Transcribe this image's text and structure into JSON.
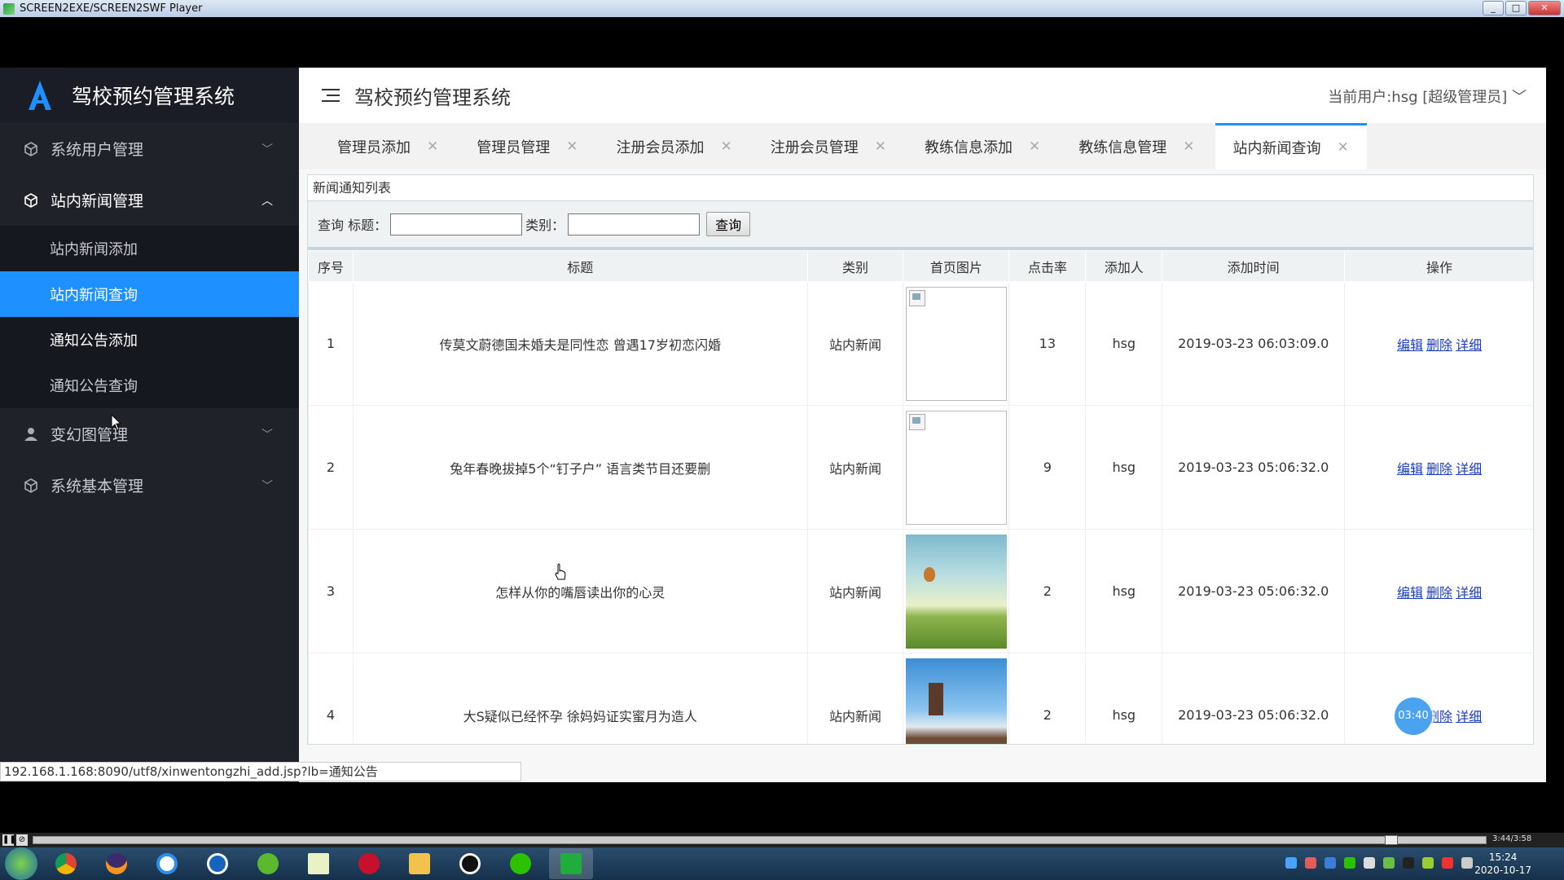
{
  "window": {
    "title": "SCREEN2EXE/SCREEN2SWF Player"
  },
  "sidebar": {
    "brand": "驾校预约管理系统",
    "menus": [
      {
        "label": "系统用户管理",
        "icon": "cube-icon",
        "expanded": false
      },
      {
        "label": "站内新闻管理",
        "icon": "cube-icon",
        "expanded": true,
        "children": [
          {
            "label": "站内新闻添加"
          },
          {
            "label": "站内新闻查询",
            "active": true
          },
          {
            "label": "通知公告添加"
          },
          {
            "label": "通知公告查询"
          }
        ]
      },
      {
        "label": "变幻图管理",
        "icon": "user-icon",
        "expanded": false
      },
      {
        "label": "系统基本管理",
        "icon": "cube-icon",
        "expanded": false
      }
    ]
  },
  "header": {
    "title": "驾校预约管理系统",
    "user": "当前用户:hsg [超级管理员]"
  },
  "tabs": [
    {
      "label": "管理员添加"
    },
    {
      "label": "管理员管理"
    },
    {
      "label": "注册会员添加"
    },
    {
      "label": "注册会员管理"
    },
    {
      "label": "教练信息添加"
    },
    {
      "label": "教练信息管理"
    },
    {
      "label": "站内新闻查询",
      "active": true
    }
  ],
  "panel": {
    "title": "新闻通知列表",
    "search": {
      "prefix": "查询",
      "title_label": "标题：",
      "title_value": "",
      "category_label": "类别：",
      "category_value": "",
      "button": "查询"
    },
    "columns": [
      "序号",
      "标题",
      "类别",
      "首页图片",
      "点击率",
      "添加人",
      "添加时间",
      "操作"
    ],
    "rows": [
      {
        "no": "1",
        "title": "传莫文蔚德国未婚夫是同性恋 曾遇17岁初恋闪婚",
        "category": "站内新闻",
        "image": "broken",
        "clicks": "13",
        "user": "hsg",
        "time": "2019-03-23 06:03:09.0"
      },
      {
        "no": "2",
        "title": "兔年春晚拔掉5个“钉子户” 语言类节目还要删",
        "category": "站内新闻",
        "image": "broken",
        "clicks": "9",
        "user": "hsg",
        "time": "2019-03-23 05:06:32.0"
      },
      {
        "no": "3",
        "title": "怎样从你的嘴唇读出你的心灵",
        "category": "站内新闻",
        "image": "sky-balloon-photo",
        "clicks": "2",
        "user": "hsg",
        "time": "2019-03-23 05:06:32.0"
      },
      {
        "no": "4",
        "title": "大S疑似已经怀孕 徐妈妈证实蜜月为造人",
        "category": "站内新闻",
        "image": "windmill-photo",
        "clicks": "2",
        "user": "hsg",
        "time": "2019-03-23 05:06:32.0"
      }
    ],
    "actions": {
      "edit": "编辑",
      "delete": "删除",
      "detail": "详细"
    }
  },
  "overlay": {
    "timer": "03:40"
  },
  "statusbar": {
    "url": "192.168.1.168:8090/utf8/xinwentongzhi_add.jsp?lb=通知公告"
  },
  "player": {
    "time": "3:44/3:58"
  },
  "taskbar": {
    "time": "15:24",
    "date": "2020-10-17"
  },
  "colors": {
    "sidebar_bg": "#20222a",
    "accent": "#1e90ff",
    "link": "#1a3cc8"
  }
}
